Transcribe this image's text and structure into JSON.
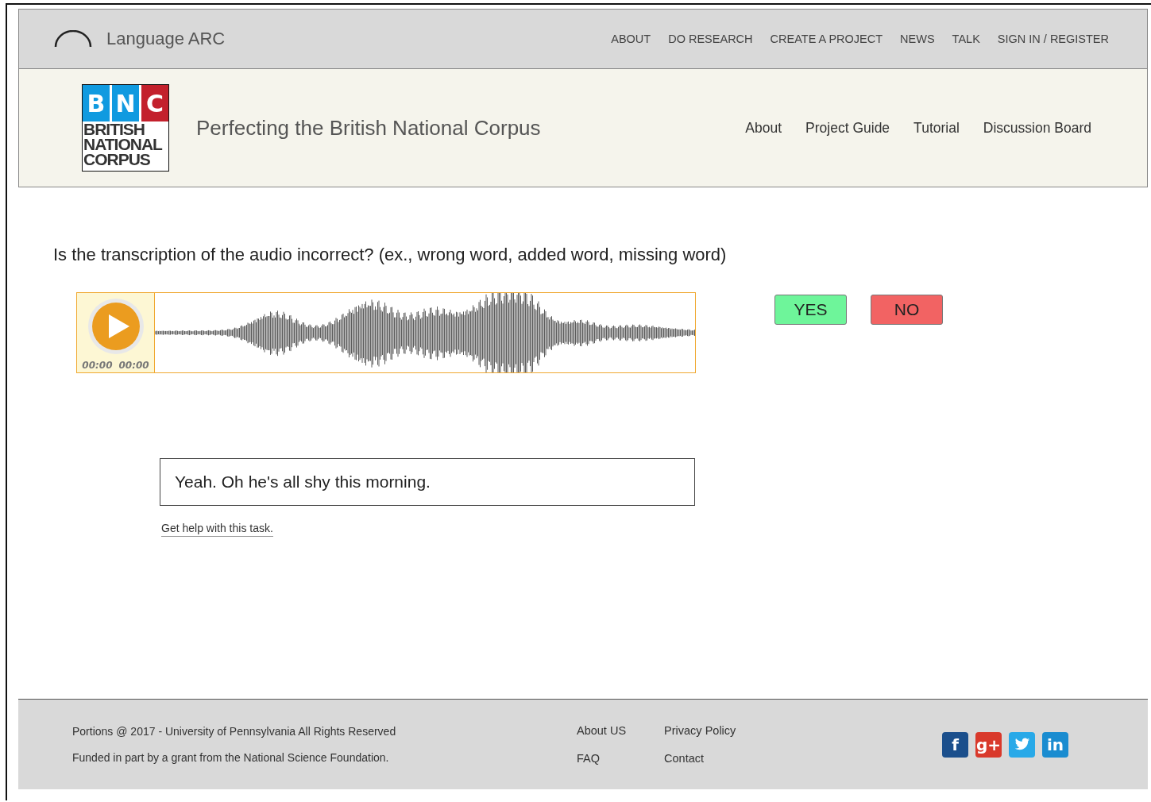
{
  "site": {
    "name": "Language ARC"
  },
  "top_nav": [
    "ABOUT",
    "DO RESEARCH",
    "CREATE A PROJECT",
    "NEWS",
    "TALK",
    "SIGN IN / REGISTER"
  ],
  "project": {
    "logo_letters": [
      "B",
      "N",
      "C"
    ],
    "logo_words": [
      "BRITISH",
      "NATIONAL",
      "CORPUS"
    ],
    "title": "Perfecting the British National Corpus"
  },
  "project_nav": [
    "About",
    "Project Guide",
    "Tutorial",
    "Discussion Board"
  ],
  "question": "Is the transcription of the audio incorrect? (ex., wrong word, added word, missing word)",
  "player": {
    "current_time": "00:00",
    "duration": "00:00"
  },
  "answers": [
    {
      "label": "YES",
      "kind": "yes"
    },
    {
      "label": "NO",
      "kind": "no"
    }
  ],
  "transcript": "Yeah. Oh he's all shy this morning.",
  "help_link": "Get help with this task.",
  "footer": {
    "lines": [
      "Portions @ 2017 - University of Pennsylvania All Rights Reserved",
      "Funded in part by a grant from the National Science Foundation."
    ],
    "links": [
      [
        "About US",
        "FAQ"
      ],
      [
        "Privacy Policy",
        "Contact"
      ]
    ],
    "social": [
      {
        "kind": "facebook",
        "label": "f"
      },
      {
        "kind": "google",
        "label": "g+"
      },
      {
        "kind": "twitter"
      },
      {
        "kind": "linkedin",
        "label": "in"
      }
    ]
  }
}
